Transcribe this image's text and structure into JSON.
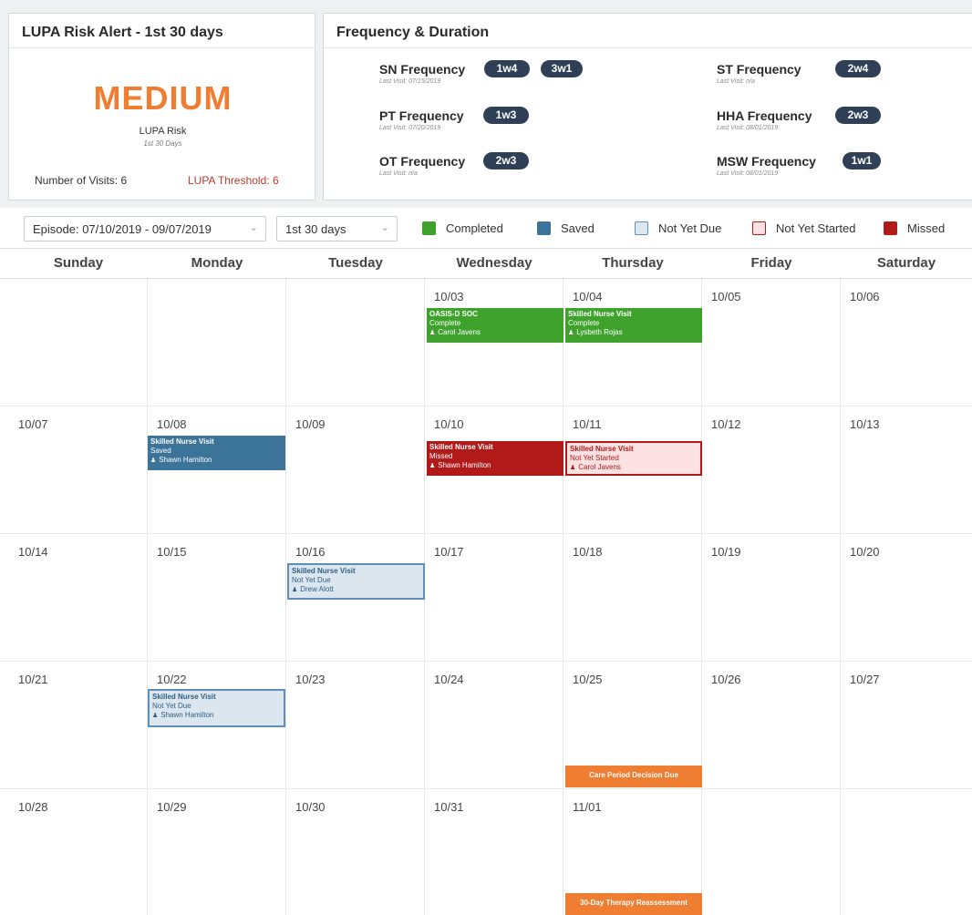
{
  "lupa": {
    "title": "LUPA Risk Alert - 1st 30 days",
    "level": "MEDIUM",
    "label": "LUPA Risk",
    "sublabel": "1st 30 Days",
    "visits": "Number of Visits: 6",
    "threshold": "LUPA Threshold: 6",
    "level_color": "#ef7d32"
  },
  "frequency": {
    "title": "Frequency & Duration",
    "items": [
      {
        "name": "SN Frequency",
        "last": "Last Visit: 07/15/2019",
        "pills": [
          "1w4",
          "3w1"
        ]
      },
      {
        "name": "PT Frequency",
        "last": "Last Visit: 07/20/2019",
        "pills": [
          "1w3"
        ]
      },
      {
        "name": "OT Frequency",
        "last": "Last Visit: n/a",
        "pills": [
          "2w3"
        ]
      },
      {
        "name": "ST Frequency",
        "last": "Last Visit: n/a",
        "pills": [
          "2w4"
        ]
      },
      {
        "name": "HHA Frequency",
        "last": "Last Visit: 08/01/2019",
        "pills": [
          "2w3"
        ]
      },
      {
        "name": "MSW Frequency",
        "last": "Last Visit: 08/01/2019",
        "pills": [
          "1w1"
        ]
      }
    ]
  },
  "toolbar": {
    "episode": "Episode: 07/10/2019 - 09/07/2019",
    "period": "1st 30 days",
    "legend": [
      {
        "label": "Completed",
        "color": "#3ea22c"
      },
      {
        "label": "Saved",
        "color": "#3b7399"
      },
      {
        "label": "Not Yet Due",
        "color": "#dce6ef"
      },
      {
        "label": "Not Yet Started",
        "color": "#fbe1e1"
      },
      {
        "label": "Missed",
        "color": "#b21a1a"
      }
    ]
  },
  "calendar": {
    "days": [
      "Sunday",
      "Monday",
      "Tuesday",
      "Wednesday",
      "Thursday",
      "Friday",
      "Saturday"
    ],
    "weeks": [
      [
        "",
        "",
        "",
        "10/03",
        "10/04",
        "10/05",
        "10/06"
      ],
      [
        "10/07",
        "10/08",
        "10/09",
        "10/10",
        "10/11",
        "10/12",
        "10/13"
      ],
      [
        "10/14",
        "10/15",
        "10/16",
        "10/17",
        "10/18",
        "10/19",
        "10/20"
      ],
      [
        "10/21",
        "10/22",
        "10/23",
        "10/24",
        "10/25",
        "10/26",
        "10/27"
      ],
      [
        "10/28",
        "10/29",
        "10/30",
        "10/31",
        "11/01",
        "",
        ""
      ]
    ],
    "events": {
      "oasis": {
        "title": "OASIS-D SOC",
        "status": "Complete",
        "person": "Carol Javens"
      },
      "snv_1004": {
        "title": "Skilled Nurse Visit",
        "status": "Complete",
        "person": "Lysbeth Rojas"
      },
      "snv_1008": {
        "title": "Skilled Nurse Visit",
        "status": "Saved",
        "person": "Shawn Hamilton"
      },
      "snv_1010": {
        "title": "Skilled Nurse Visit",
        "status": "Missed",
        "person": "Shawn Hamilton"
      },
      "snv_1011": {
        "title": "Skilled Nurse Visit",
        "status": "Not Yet Started",
        "person": "Carol Javens"
      },
      "snv_1016": {
        "title": "Skilled Nurse Visit",
        "status": "Not Yet Due",
        "person": "Drew Alott"
      },
      "snv_1022": {
        "title": "Skilled Nurse Visit",
        "status": "Not Yet Due",
        "person": "Shawn Hamilton"
      },
      "decision": {
        "title": "Care Period Decision Due"
      },
      "therapy": {
        "title": "30-Day Therapy Reassessment"
      }
    }
  }
}
